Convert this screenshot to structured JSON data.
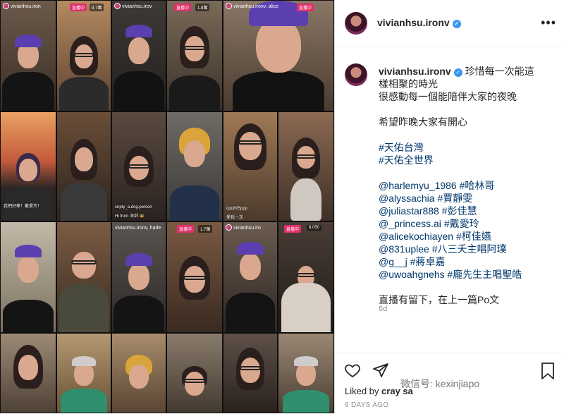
{
  "post": {
    "author": "vivianhsu.ironv",
    "more_label": "•••",
    "caption_lines": [
      "珍惜每一次能這",
      "樣相聚的時光",
      "很感動每一個能陪伴大家的夜晚"
    ],
    "wish": "希望昨晚大家有開心",
    "hashtags": [
      "#天佑台灣",
      "#天佑全世界"
    ],
    "mentions": [
      {
        "handle": "@harlemyu_1986",
        "tag": "#哈林哥"
      },
      {
        "handle": "@alyssachia",
        "tag": "#賈靜雯"
      },
      {
        "handle": "@juliastar888",
        "tag": "#彭佳慧"
      },
      {
        "handle": "@_princess.ai",
        "tag": "#戴愛玲"
      },
      {
        "handle": "@alicekochiayen",
        "tag": "#柯佳嬿"
      },
      {
        "handle": "@831uplee",
        "tag": "#八三夭主唱阿璞"
      },
      {
        "handle": "@g__j",
        "tag": "#蔣卓嘉"
      },
      {
        "handle": "@uwoahgnehs",
        "tag": "#龐先生主唱聖皓"
      }
    ],
    "closing": "直播有留下，在上一篇Po文",
    "age": "6d",
    "liked_by_prefix": "Liked by",
    "liked_by_user": "cray",
    "liked_by_rest": "sa",
    "date": "6 DAYS AGO"
  },
  "watermark": "微信号: kexinjiapo",
  "collage": {
    "live_label": "直播中",
    "views": [
      "9.7萬",
      "1.8萬",
      "1.7萬",
      "8,050"
    ],
    "usernames": [
      "vivianhsu.iron",
      "vivianhsu.irov",
      "vivianhsu.ironv, alice",
      "vivianhsu.ironv, harle",
      "vivianhsu.iro"
    ],
    "comments": [
      "我們好棒！戴愛玲！",
      "snpty_a.dog.person",
      "Hi from 深圳 🐝",
      "qqq805ppp",
      "愛我一次"
    ]
  },
  "colors": {
    "accent": "#e1306c",
    "link": "#00376b",
    "verified": "#3897f0",
    "cap": "#5b3fb0"
  }
}
